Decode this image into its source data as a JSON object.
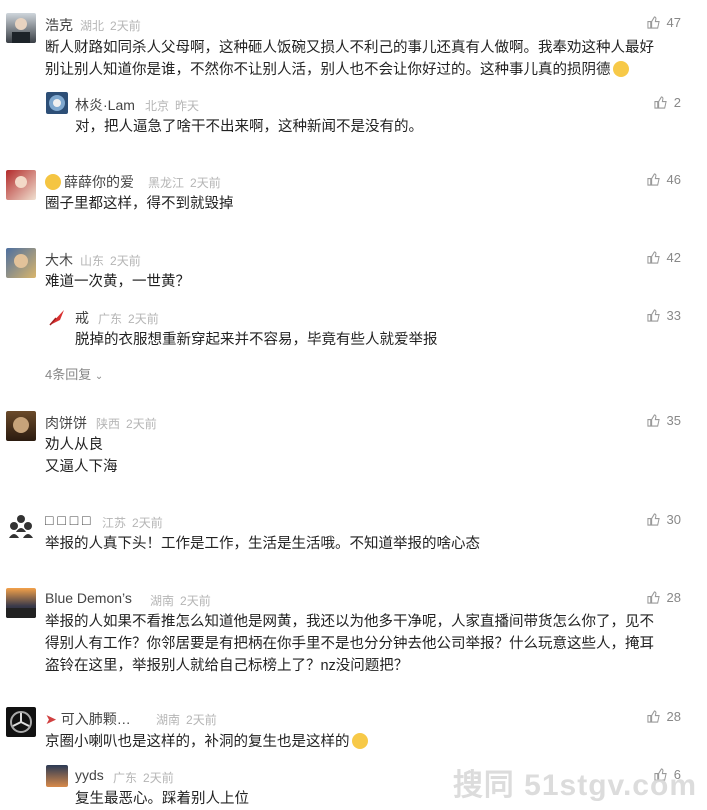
{
  "comments": [
    {
      "name": "浩克",
      "location": "湖北",
      "time": "2天前",
      "likes": "47",
      "text": "断人财路如同杀人父母啊，这种砸人饭碗又损人不利己的事儿还真有人做啊。我奉劝这种人最好\n别让别人知道你是谁，不然你不让别人活，别人也不会让你好过的。这种事儿真的损阴德",
      "reply": {
        "name": "林炎·Lam",
        "location": "北京",
        "time": "昨天",
        "likes": "2",
        "text": "对，把人逼急了啥干不出来啊，这种新闻不是没有的。"
      }
    },
    {
      "name": "薛薛你的爱",
      "location": "黑龙江",
      "time": "2天前",
      "likes": "46",
      "text": "圈子里都这样，得不到就毁掉"
    },
    {
      "name": "大木",
      "location": "山东",
      "time": "2天前",
      "likes": "42",
      "text": "难道一次黄，一世黄？",
      "reply": {
        "name": "戒",
        "location": "广东",
        "time": "2天前",
        "likes": "33",
        "text": "脱掉的衣服想重新穿起来并不容易，毕竟有些人就爱举报"
      },
      "more": "4条回复"
    },
    {
      "name": "肉饼饼",
      "location": "陕西",
      "time": "2天前",
      "likes": "35",
      "text": "劝人从良\n又逼人下海"
    },
    {
      "name": "□ □ □ □",
      "location": "江苏",
      "time": "2天前",
      "likes": "30",
      "text": "举报的人真下头！工作是工作，生活是生活哦。不知道举报的啥心态"
    },
    {
      "name": "Blue Demon’s",
      "location": "湖南",
      "time": "2天前",
      "likes": "28",
      "text": "举报的人如果不看推怎么知道他是网黄，我还以为他多干净呢，人家直播间带货怎么你了，见不\n得别人有工作？你邻居要是有把柄在你手里不是也分分钟去他公司举报？什么玩意这些人，掩耳\n盗铃在这里，举报别人就给自己标榜上了？nz没问题把？"
    },
    {
      "name": "可入肺颗…",
      "location": "湖南",
      "time": "2天前",
      "likes": "28",
      "text": "京圈小喇叭也是这样的，补洞的复生也是这样的",
      "reply": {
        "name": "yyds",
        "location": "广东",
        "time": "2天前",
        "likes": "6",
        "text": "复生最恶心。踩着别人上位"
      }
    }
  ],
  "watermark": "搜同 51stgv.com"
}
